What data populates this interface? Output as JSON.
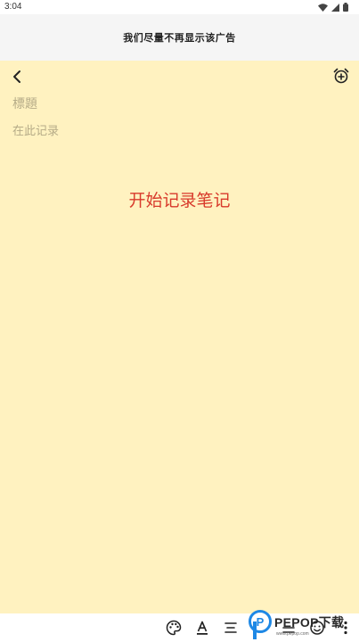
{
  "status_bar": {
    "time": "3:04",
    "icons": [
      "wifi-icon",
      "signal-icon",
      "battery-icon"
    ]
  },
  "ad_banner": {
    "text": "我们尽量不再显示该广告"
  },
  "note": {
    "title_placeholder": "標題",
    "body_placeholder": "在此记录",
    "empty_hint": "开始记录笔记"
  },
  "toolbar": {
    "top_icons": [
      "back-arrow-icon",
      "add-alarm-icon"
    ],
    "bottom_icons": [
      "palette-icon",
      "text-format-icon",
      "align-icon",
      "checklist-icon",
      "emoji-icon",
      "more-icon"
    ]
  },
  "watermark": {
    "logo_letter": "P",
    "text": "PEPOP下载",
    "sub": "www.pepop.com"
  },
  "colors": {
    "note_background": "#fff2c0",
    "hint_red": "#d83a2b",
    "placeholder": "#b5ab87"
  }
}
